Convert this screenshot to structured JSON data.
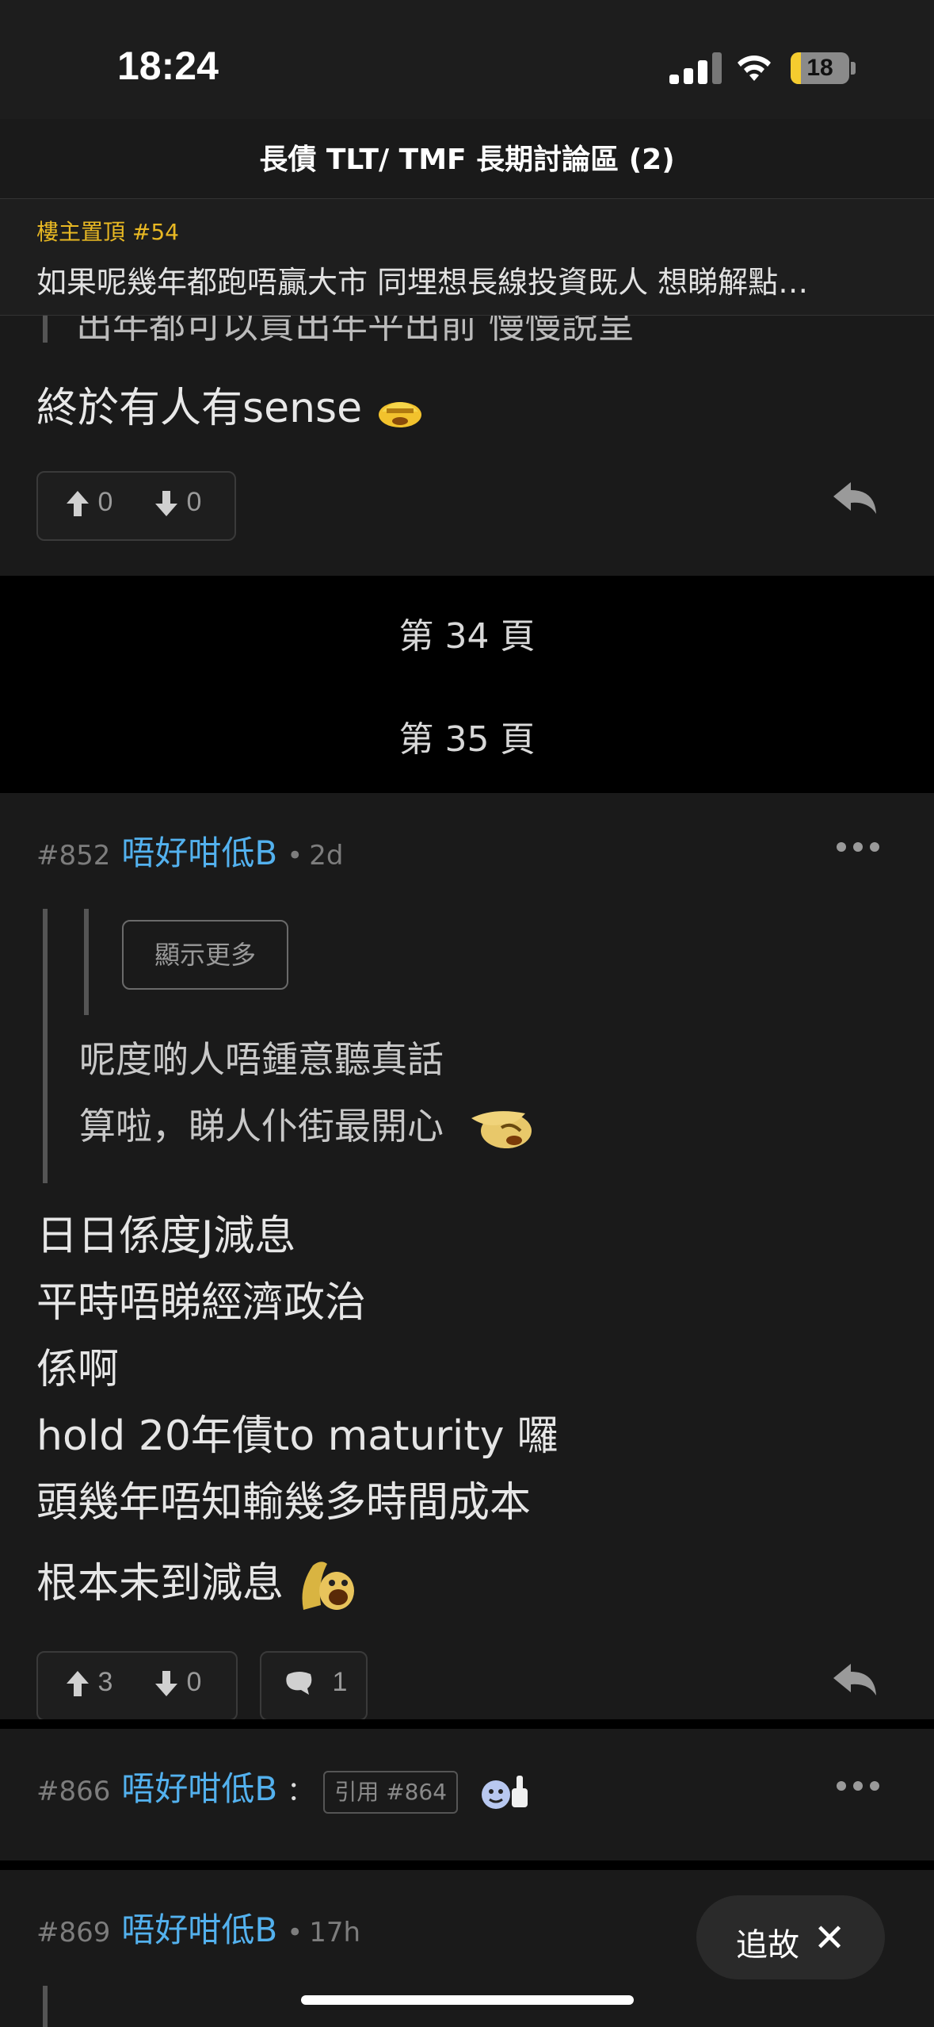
{
  "status_bar": {
    "time": "18:24",
    "battery": "18",
    "battery_level": 0.18
  },
  "nav": {
    "title": "長債 TLT/ TMF 長期討論區 (2)"
  },
  "pinned": {
    "tag": "樓主置頂 #54",
    "text": "如果呢幾年都跑唔贏大市 同埋想長線投資既人 想睇解點…"
  },
  "prev_post": {
    "quote_partial": "出年都可以買出年平出前 慢慢說呈",
    "text": "終於有人有sense",
    "upvotes": "0",
    "downvotes": "0"
  },
  "pages": [
    "第 34 頁",
    "第 35 頁"
  ],
  "post_852": {
    "number": "#852",
    "user": "唔好咁低B",
    "sep": "•",
    "time": "2d",
    "show_more": "顯示更多",
    "quote_lines": [
      "呢度啲人唔鍾意聽真話",
      "算啦，睇人仆街最開心"
    ],
    "body_lines": [
      "日日係度J減息",
      "平時唔睇經濟政治",
      "係啊",
      "hold 20年債to maturity 囉",
      "頭幾年唔知輸幾多時間成本"
    ],
    "last_line": "根本未到減息",
    "upvotes": "3",
    "downvotes": "0",
    "comments": "1"
  },
  "post_866": {
    "number": "#866",
    "user": "唔好咁低B",
    "colon": "：",
    "quote_ref": "引用 #864"
  },
  "post_869": {
    "number": "#869",
    "user": "唔好咁低B",
    "sep": "•",
    "time": "17h"
  },
  "follow": {
    "label": "追故"
  },
  "colors": {
    "accent_blue": "#53b1ee",
    "pinned_gold": "#e8b823",
    "background": "#1a1a1a"
  }
}
